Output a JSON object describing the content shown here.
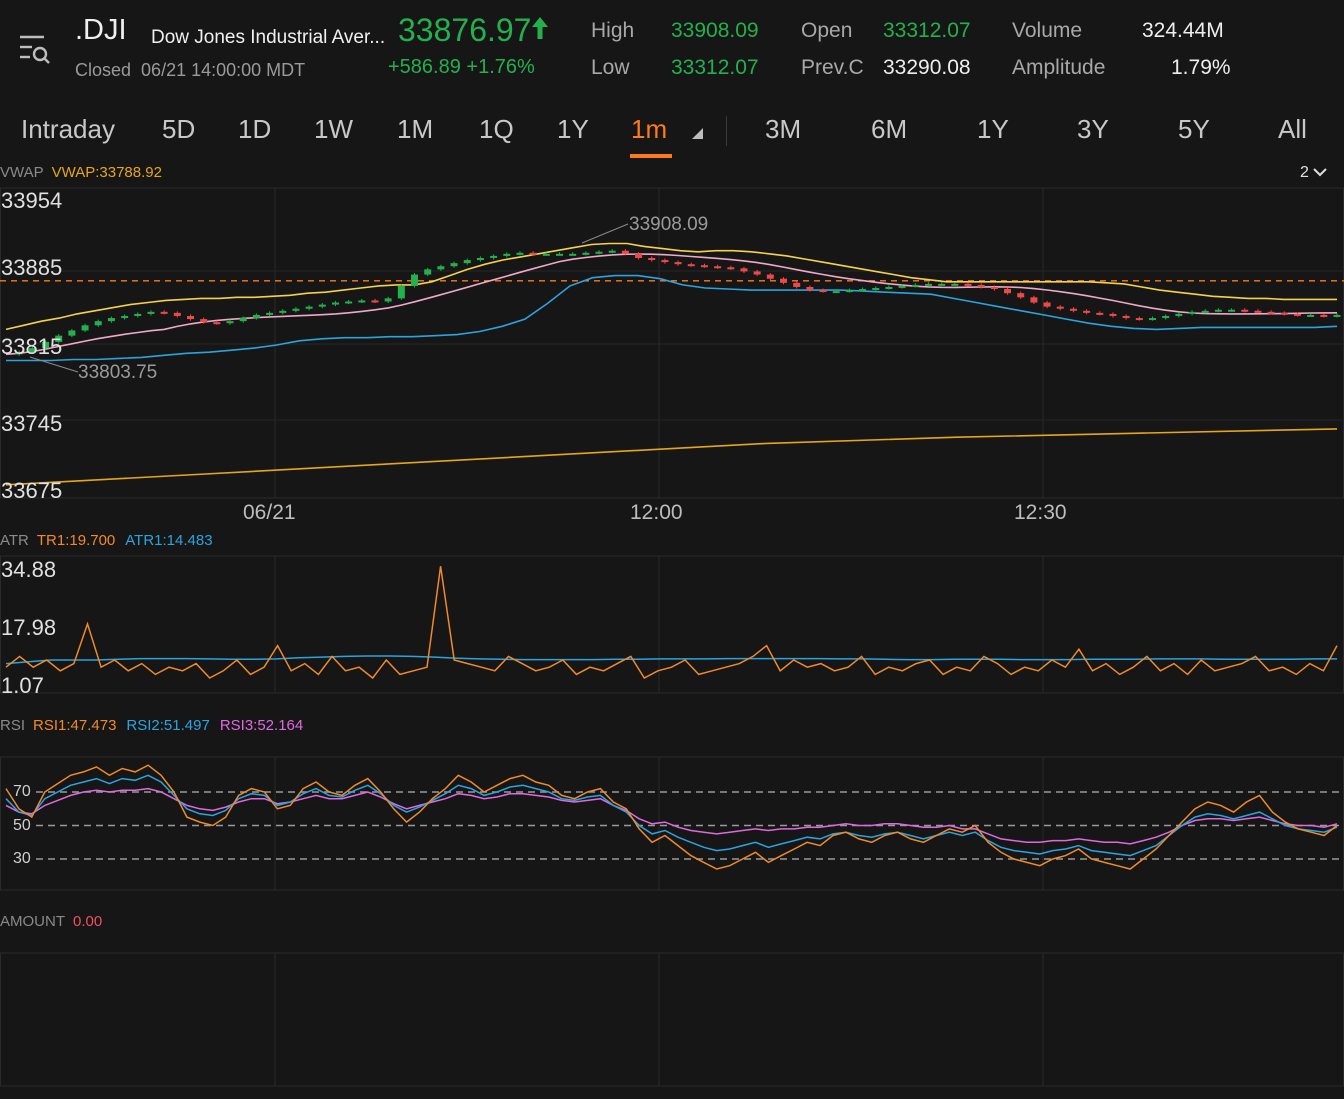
{
  "header": {
    "symbol": ".DJI",
    "name": "Dow Jones Industrial Aver...",
    "status": "Closed",
    "timestamp": "06/21 14:00:00 MDT",
    "price": "33876.97",
    "change": "+586.89",
    "change_pct": "+1.76%",
    "high_label": "High",
    "high": "33908.09",
    "low_label": "Low",
    "low": "33312.07",
    "open_label": "Open",
    "open": "33312.07",
    "prevc_label": "Prev.C",
    "prevc": "33290.08",
    "volume_label": "Volume",
    "volume": "324.44M",
    "amplitude_label": "Amplitude",
    "amplitude": "1.79%",
    "up_color": "#22b14c",
    "down_color": "#f04848"
  },
  "tabs": [
    "Intraday",
    "5D",
    "1D",
    "1W",
    "1M",
    "1Q",
    "1Y",
    "1m",
    "3M",
    "6M",
    "1Y",
    "3Y",
    "5Y",
    "All"
  ],
  "active_tab": "1m",
  "main_panel": {
    "indicator": "VWAP",
    "value_label": "VWAP:33788.92",
    "selector": "2",
    "y_ticks": [
      "33954",
      "33885",
      "33815",
      "33745",
      "33675"
    ],
    "x_ticks": [
      "06/21",
      "12:00",
      "12:30"
    ],
    "high_annotation": "33908.09",
    "low_annotation": "33803.75"
  },
  "atr_panel": {
    "name": "ATR",
    "tr_label": "TR1:19.700",
    "atr_label": "ATR1:14.483",
    "y_ticks": [
      "34.88",
      "17.98",
      "1.07"
    ]
  },
  "rsi_panel": {
    "name": "RSI",
    "rsi1_label": "RSI1:47.473",
    "rsi2_label": "RSI2:51.497",
    "rsi3_label": "RSI3:52.164",
    "levels": [
      "70",
      "50",
      "30"
    ]
  },
  "amount_panel": {
    "name": "AMOUNT",
    "value": "0.00"
  },
  "chart_data": {
    "type": "line",
    "price_y_range": [
      33675,
      33954
    ],
    "reference_line": 33876.97,
    "close": [
      33806,
      33808,
      33812,
      33818,
      33824,
      33829,
      33834,
      33838,
      33841,
      33843,
      33845,
      33847,
      33846,
      33843,
      33840,
      33837,
      33836,
      33838,
      33841,
      33844,
      33846,
      33848,
      33850,
      33852,
      33854,
      33856,
      33857,
      33858,
      33857,
      33860,
      33872,
      33883,
      33888,
      33891,
      33894,
      33897,
      33899,
      33901,
      33903,
      33904,
      33903,
      33903,
      33903,
      33903,
      33904,
      33905,
      33906,
      33903,
      33899,
      33897,
      33895,
      33893,
      33892,
      33891,
      33890,
      33889,
      33886,
      33883,
      33879,
      33875,
      33871,
      33868,
      33867,
      33867,
      33868,
      33869,
      33870,
      33871,
      33872,
      33873,
      33874,
      33874,
      33874,
      33873,
      33871,
      33869,
      33865,
      33861,
      33856,
      33852,
      33850,
      33848,
      33846,
      33845,
      33843,
      33841,
      33840,
      33841,
      33843,
      33845,
      33847,
      33848,
      33849,
      33849,
      33848,
      33847,
      33846,
      33845,
      33844,
      33844,
      33843,
      33844
    ],
    "bb_upper": [
      33830,
      33834,
      33838,
      33841,
      33845,
      33848,
      33851,
      33854,
      33856,
      33858,
      33859,
      33860,
      33860,
      33861,
      33861,
      33862,
      33863,
      33865,
      33866,
      33868,
      33870,
      33872,
      33873,
      33873,
      33876,
      33882,
      33888,
      33893,
      33897,
      33900,
      33903,
      33906,
      33909,
      33912,
      33913,
      33913,
      33910,
      33908,
      33906,
      33905,
      33906,
      33906,
      33905,
      33903,
      33901,
      33898,
      33895,
      33892,
      33889,
      33886,
      33883,
      33880,
      33878,
      33876,
      33876,
      33876,
      33876,
      33876,
      33876,
      33876,
      33876,
      33876,
      33875,
      33874,
      33871,
      33868,
      33866,
      33864,
      33862,
      33861,
      33860,
      33860,
      33859,
      33859,
      33859,
      33859
    ],
    "bb_lower": [
      33800,
      33800,
      33800,
      33801,
      33801,
      33802,
      33803,
      33805,
      33807,
      33808,
      33810,
      33812,
      33815,
      33819,
      33821,
      33822,
      33822,
      33823,
      33823,
      33824,
      33825,
      33828,
      33833,
      33840,
      33855,
      33872,
      33880,
      33882,
      33882,
      33879,
      33873,
      33870,
      33869,
      33868,
      33868,
      33868,
      33868,
      33868,
      33867,
      33866,
      33865,
      33864,
      33860,
      33856,
      33852,
      33848,
      33844,
      33840,
      33836,
      33833,
      33831,
      33830,
      33831,
      33832,
      33832,
      33832,
      33832,
      33832,
      33832,
      33833
    ],
    "vwap": [
      33680,
      33690,
      33700,
      33710,
      33720,
      33726,
      33730,
      33734
    ],
    "atr_y_range": [
      1.07,
      34.88
    ],
    "tr": [
      6,
      9,
      6,
      8,
      5,
      7,
      18,
      6,
      8,
      5,
      7,
      4,
      6,
      5,
      7,
      3,
      5,
      8,
      4,
      6,
      12,
      5,
      7,
      4,
      9,
      5,
      6,
      3,
      8,
      4,
      5,
      6,
      34,
      8,
      7,
      6,
      5,
      9,
      7,
      5,
      6,
      8,
      4,
      6,
      5,
      7,
      9,
      3,
      5,
      6,
      8,
      4,
      5,
      6,
      7,
      9,
      12,
      5,
      8,
      6,
      7,
      5,
      6,
      9,
      4,
      6,
      5,
      7,
      8,
      4,
      6,
      5,
      9,
      7,
      4,
      6,
      5,
      8,
      6,
      11,
      5,
      7,
      4,
      6,
      9,
      5,
      7,
      4,
      8,
      5,
      6,
      7,
      9,
      5,
      6,
      4,
      7,
      5,
      12
    ],
    "atr": [
      7,
      7.5,
      8,
      8,
      8,
      8.2,
      8.4,
      8.4,
      8.4,
      8.3,
      8.2,
      8.2,
      8.3,
      8.6,
      8.8,
      9,
      9.1,
      9.1,
      9,
      8.8,
      8.5,
      8.3,
      8.2,
      8.1,
      8.1,
      8.1,
      8.1,
      8.2,
      8.2,
      8.3,
      8.3,
      8.3,
      8.4,
      8.4,
      8.4,
      8.4,
      8.4,
      8.3,
      8.3,
      8.2,
      8.1,
      8.1,
      8.2,
      8.2,
      8.2,
      8.1,
      8.1,
      8.1,
      8.2,
      8.2,
      8.2,
      8.3,
      8.3,
      8.3,
      8.2,
      8.2,
      8.2,
      8.2,
      8.3,
      8.3
    ],
    "rsi_y_range": [
      0,
      100
    ],
    "rsi1": [
      72,
      60,
      55,
      70,
      75,
      80,
      82,
      85,
      80,
      84,
      82,
      86,
      80,
      70,
      55,
      52,
      50,
      55,
      68,
      72,
      70,
      60,
      62,
      72,
      76,
      70,
      68,
      74,
      78,
      70,
      60,
      52,
      58,
      66,
      72,
      80,
      76,
      70,
      74,
      78,
      80,
      76,
      74,
      68,
      66,
      70,
      72,
      64,
      60,
      48,
      40,
      44,
      38,
      32,
      28,
      24,
      26,
      30,
      34,
      28,
      32,
      36,
      40,
      38,
      44,
      46,
      42,
      40,
      44,
      46,
      42,
      40,
      44,
      48,
      46,
      50,
      40,
      34,
      30,
      28,
      26,
      30,
      32,
      36,
      30,
      28,
      26,
      24,
      30,
      36,
      44,
      52,
      60,
      64,
      62,
      58,
      64,
      68,
      58,
      52,
      48,
      46,
      44,
      50
    ],
    "rsi2": [
      66,
      58,
      56,
      66,
      70,
      74,
      76,
      78,
      75,
      78,
      77,
      80,
      76,
      68,
      60,
      57,
      56,
      59,
      66,
      69,
      68,
      62,
      64,
      69,
      72,
      68,
      67,
      71,
      74,
      69,
      62,
      58,
      61,
      65,
      69,
      74,
      72,
      68,
      70,
      73,
      74,
      72,
      70,
      66,
      65,
      67,
      68,
      62,
      58,
      50,
      45,
      47,
      43,
      40,
      37,
      35,
      36,
      38,
      40,
      37,
      39,
      41,
      43,
      42,
      45,
      46,
      44,
      43,
      45,
      46,
      44,
      42,
      44,
      46,
      44,
      46,
      41,
      37,
      35,
      34,
      33,
      35,
      36,
      38,
      35,
      34,
      33,
      32,
      35,
      38,
      44,
      50,
      55,
      57,
      56,
      54,
      56,
      58,
      54,
      50,
      48,
      47,
      46,
      49
    ],
    "rsi3": [
      62,
      58,
      57,
      62,
      65,
      68,
      70,
      71,
      70,
      71,
      71,
      72,
      70,
      66,
      62,
      60,
      59,
      61,
      64,
      66,
      66,
      63,
      64,
      66,
      68,
      66,
      66,
      68,
      70,
      67,
      63,
      60,
      62,
      64,
      66,
      69,
      68,
      66,
      67,
      69,
      69,
      68,
      67,
      65,
      64,
      65,
      66,
      62,
      59,
      54,
      51,
      52,
      49,
      47,
      46,
      45,
      46,
      47,
      48,
      47,
      48,
      48,
      49,
      49,
      50,
      51,
      50,
      50,
      51,
      51,
      50,
      49,
      49,
      50,
      48,
      48,
      45,
      42,
      41,
      40,
      40,
      41,
      41,
      42,
      41,
      40,
      40,
      39,
      41,
      43,
      46,
      50,
      53,
      54,
      54,
      53,
      54,
      55,
      53,
      51,
      50,
      50,
      49,
      51
    ],
    "series_colors": {
      "bb_upper": "#f5d24a",
      "bb_mid": "#f0a8c8",
      "bb_lower": "#2aa4e0",
      "vwap": "#e8a51a",
      "tr": "#f08a2a",
      "atr": "#2aa4e0",
      "rsi1": "#f08a2a",
      "rsi2": "#2aa4e0",
      "rsi3": "#e069e0"
    }
  }
}
